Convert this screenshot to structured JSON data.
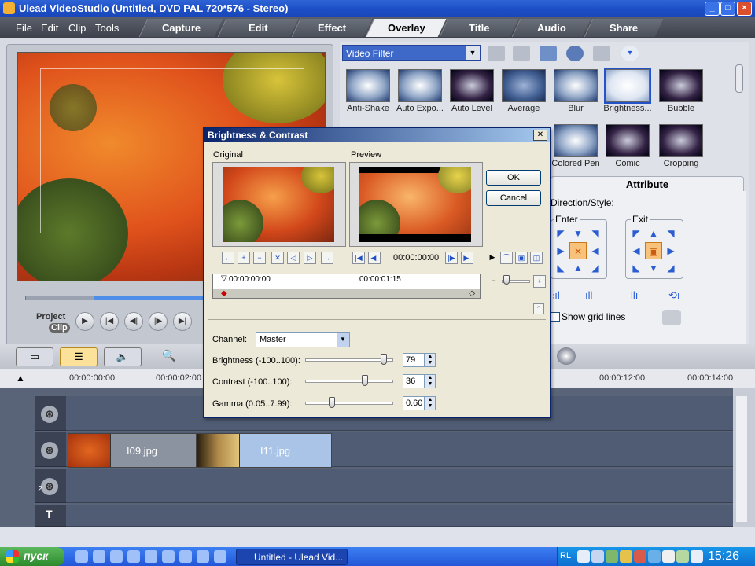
{
  "window": {
    "title": "Ulead VideoStudio (Untitled, DVD PAL 720*576 - Stereo)"
  },
  "menu": [
    "File",
    "Edit",
    "Clip",
    "Tools"
  ],
  "steps": [
    "Capture",
    "Edit",
    "Effect",
    "Overlay",
    "Title",
    "Audio",
    "Share"
  ],
  "active_step": "Overlay",
  "library": {
    "category": "Video Filter",
    "filters_row1": [
      "Anti-Shake",
      "Auto Expo...",
      "Auto Level",
      "Average",
      "Blur",
      "Brightness...",
      "Bubble"
    ],
    "filters_row2": [
      "Colored Pen",
      "Comic",
      "Cropping"
    ]
  },
  "player": {
    "project_label": "Project",
    "clip_label": "Clip"
  },
  "attribute": {
    "tab": "Attribute",
    "direction_style": "Direction/Style:",
    "enter": "Enter",
    "exit": "Exit",
    "show_grid": "Show grid lines"
  },
  "dialog": {
    "title": "Brightness & Contrast",
    "original": "Original",
    "preview": "Preview",
    "ok": "OK",
    "cancel": "Cancel",
    "timecode": "00:00:00:00",
    "timeline_start": "00:00:00:00",
    "timeline_mid": "00:00:01:15",
    "channel_label": "Channel:",
    "channel_value": "Master",
    "brightness_label": "Brightness (-100..100):",
    "brightness_value": "79",
    "contrast_label": "Contrast (-100..100):",
    "contrast_value": "36",
    "gamma_label": "Gamma (0.05..7.99):",
    "gamma_value": "0.60",
    "brightness_level": 0.895,
    "contrast_level": 0.68,
    "gamma_level": 0.3
  },
  "timeline": {
    "ruler": [
      "00:00:00:00",
      "00:00:02:00",
      "00:00:12:00",
      "00:00:14:00"
    ],
    "clips": [
      "I09.jpg",
      "I11.jpg"
    ],
    "title_track": "T",
    "overlay_num": "2"
  },
  "taskbar": {
    "start": "пуск",
    "task": "Untitled - Ulead Vid...",
    "lang": "RL",
    "clock": "15:26"
  }
}
